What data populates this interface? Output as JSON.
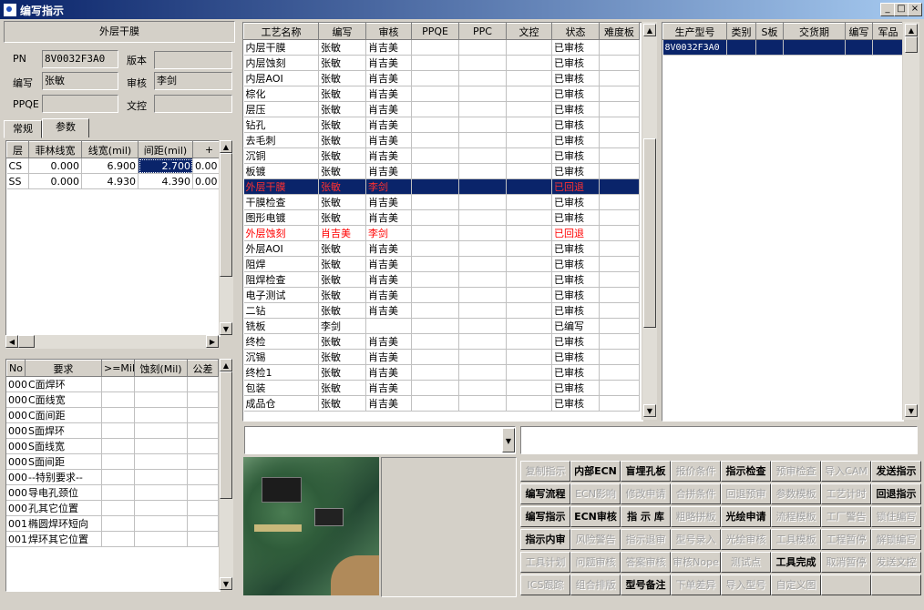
{
  "window": {
    "title": "编写指示",
    "min": "_",
    "max": "□",
    "close": "×"
  },
  "left": {
    "header": "外层干膜",
    "pn_label": "PN",
    "pn_value": "8V0032F3A0",
    "version_label": "版本",
    "version_value": "",
    "author_label": "编写",
    "author_value": "张敏",
    "review_label": "审核",
    "review_value": "李剑",
    "ppqe_label": "PPQE",
    "ppqe_value": "",
    "doc_label": "文控",
    "doc_value": "",
    "tabs": [
      "常规",
      "参数"
    ],
    "param_table": {
      "columns": [
        "层",
        "菲林线宽",
        "线宽(mil)",
        "间距(mil)",
        "+"
      ],
      "rows": [
        [
          "CS",
          "0.000",
          "6.900",
          "2.700",
          "0.00"
        ],
        [
          "SS",
          "0.000",
          "4.930",
          "4.390",
          "0.00"
        ]
      ]
    },
    "req_table": {
      "columns": [
        "No",
        "要求",
        ">=Mil",
        "蚀刻(Mil)",
        "公差"
      ],
      "rows": [
        [
          "000",
          "C面焊环"
        ],
        [
          "000",
          "C面线宽"
        ],
        [
          "000",
          "C面间距"
        ],
        [
          "000",
          "S面焊环"
        ],
        [
          "000",
          "S面线宽"
        ],
        [
          "000",
          "S面间距"
        ],
        [
          "000",
          "--特别要求--"
        ],
        [
          "000",
          "导电孔颈位"
        ],
        [
          "000",
          "孔其它位置"
        ],
        [
          "001",
          "椭圆焊环短向"
        ],
        [
          "001",
          "焊环其它位置"
        ]
      ]
    }
  },
  "process": {
    "columns": [
      "工艺名称",
      "编写",
      "审核",
      "PPQE",
      "PPC",
      "文控",
      "状态",
      "难度板"
    ],
    "rows": [
      {
        "name": "内层干膜",
        "author": "张敏",
        "reviewer": "肖吉美",
        "status": "已审核",
        "state": "normal"
      },
      {
        "name": "内层蚀刻",
        "author": "张敏",
        "reviewer": "肖吉美",
        "status": "已审核",
        "state": "normal"
      },
      {
        "name": "内层AOI",
        "author": "张敏",
        "reviewer": "肖吉美",
        "status": "已审核",
        "state": "normal"
      },
      {
        "name": "棕化",
        "author": "张敏",
        "reviewer": "肖吉美",
        "status": "已审核",
        "state": "normal"
      },
      {
        "name": "层压",
        "author": "张敏",
        "reviewer": "肖吉美",
        "status": "已审核",
        "state": "normal"
      },
      {
        "name": "钻孔",
        "author": "张敏",
        "reviewer": "肖吉美",
        "status": "已审核",
        "state": "normal"
      },
      {
        "name": "去毛刺",
        "author": "张敏",
        "reviewer": "肖吉美",
        "status": "已审核",
        "state": "normal"
      },
      {
        "name": "沉铜",
        "author": "张敏",
        "reviewer": "肖吉美",
        "status": "已审核",
        "state": "normal"
      },
      {
        "name": "板镀",
        "author": "张敏",
        "reviewer": "肖吉美",
        "status": "已审核",
        "state": "normal"
      },
      {
        "name": "外层干膜",
        "author": "张敏",
        "reviewer": "李剑",
        "status": "已回退",
        "state": "selected"
      },
      {
        "name": "干膜检查",
        "author": "张敏",
        "reviewer": "肖吉美",
        "status": "已审核",
        "state": "normal"
      },
      {
        "name": "图形电镀",
        "author": "张敏",
        "reviewer": "肖吉美",
        "status": "已审核",
        "state": "normal"
      },
      {
        "name": "外层蚀刻",
        "author": "肖吉美",
        "reviewer": "李剑",
        "status": "已回退",
        "state": "rejected"
      },
      {
        "name": "外层AOI",
        "author": "张敏",
        "reviewer": "肖吉美",
        "status": "已审核",
        "state": "normal"
      },
      {
        "name": "阻焊",
        "author": "张敏",
        "reviewer": "肖吉美",
        "status": "已审核",
        "state": "normal"
      },
      {
        "name": "阻焊检查",
        "author": "张敏",
        "reviewer": "肖吉美",
        "status": "已审核",
        "state": "normal"
      },
      {
        "name": "电子测试",
        "author": "张敏",
        "reviewer": "肖吉美",
        "status": "已审核",
        "state": "normal"
      },
      {
        "name": "二钻",
        "author": "张敏",
        "reviewer": "肖吉美",
        "status": "已审核",
        "state": "normal"
      },
      {
        "name": "铣板",
        "author": "李剑",
        "reviewer": "",
        "status": "已编写",
        "state": "normal"
      },
      {
        "name": "终检",
        "author": "张敏",
        "reviewer": "肖吉美",
        "status": "已审核",
        "state": "normal"
      },
      {
        "name": "沉锡",
        "author": "张敏",
        "reviewer": "肖吉美",
        "status": "已审核",
        "state": "normal"
      },
      {
        "name": "终检1",
        "author": "张敏",
        "reviewer": "肖吉美",
        "status": "已审核",
        "state": "normal"
      },
      {
        "name": "包装",
        "author": "张敏",
        "reviewer": "肖吉美",
        "status": "已审核",
        "state": "normal"
      },
      {
        "name": "成品仓",
        "author": "张敏",
        "reviewer": "肖吉美",
        "status": "已审核",
        "state": "normal"
      }
    ]
  },
  "models": {
    "columns": [
      "生产型号",
      "类别",
      "S板",
      "交货期",
      "编写",
      "军品"
    ],
    "rows": [
      [
        "8V0032F3A0",
        "",
        "",
        "",
        "",
        ""
      ]
    ]
  },
  "buttons": [
    {
      "label": "复制指示",
      "state": "off"
    },
    {
      "label": "内部ECN",
      "state": "on"
    },
    {
      "label": "盲埋孔板",
      "state": "on"
    },
    {
      "label": "报价条件",
      "state": "off"
    },
    {
      "label": "指示检查",
      "state": "on"
    },
    {
      "label": "预审检查",
      "state": "off"
    },
    {
      "label": "导入CAM",
      "state": "off"
    },
    {
      "label": "发送指示",
      "state": "on"
    },
    {
      "label": "编写流程",
      "state": "on"
    },
    {
      "label": "ECN影响",
      "state": "off"
    },
    {
      "label": "修改申请",
      "state": "off"
    },
    {
      "label": "合拼条件",
      "state": "off"
    },
    {
      "label": "回退预审",
      "state": "off"
    },
    {
      "label": "参数模板",
      "state": "off"
    },
    {
      "label": "工艺计时",
      "state": "off"
    },
    {
      "label": "回退指示",
      "state": "on"
    },
    {
      "label": "编写指示",
      "state": "on"
    },
    {
      "label": "ECN审核",
      "state": "on"
    },
    {
      "label": "指 示 库",
      "state": "on"
    },
    {
      "label": "粗略拼板",
      "state": "off"
    },
    {
      "label": "光绘申请",
      "state": "on"
    },
    {
      "label": "流程模板",
      "state": "off"
    },
    {
      "label": "工厂警告",
      "state": "off"
    },
    {
      "label": "锁住编写",
      "state": "off"
    },
    {
      "label": "指示内审",
      "state": "on"
    },
    {
      "label": "风险警告",
      "state": "off"
    },
    {
      "label": "指示退审",
      "state": "off"
    },
    {
      "label": "型号录入",
      "state": "off"
    },
    {
      "label": "光绘审核",
      "state": "off"
    },
    {
      "label": "工具模板",
      "state": "off"
    },
    {
      "label": "工程暂停",
      "state": "off"
    },
    {
      "label": "解锁编写",
      "state": "off"
    },
    {
      "label": "工具计划",
      "state": "off"
    },
    {
      "label": "问题审核",
      "state": "off"
    },
    {
      "label": "答案审核",
      "state": "off"
    },
    {
      "label": "审核Nope",
      "state": "off"
    },
    {
      "label": "测试点",
      "state": "off"
    },
    {
      "label": "工具完成",
      "state": "on"
    },
    {
      "label": "取消暂停",
      "state": "off"
    },
    {
      "label": "发送文控",
      "state": "off"
    },
    {
      "label": "ICS跟踪",
      "state": "off"
    },
    {
      "label": "组合排版",
      "state": "off"
    },
    {
      "label": "型号备注",
      "state": "on"
    },
    {
      "label": "下单差异",
      "state": "off"
    },
    {
      "label": "导入型号",
      "state": "off"
    },
    {
      "label": "自定义图",
      "state": "off"
    }
  ]
}
